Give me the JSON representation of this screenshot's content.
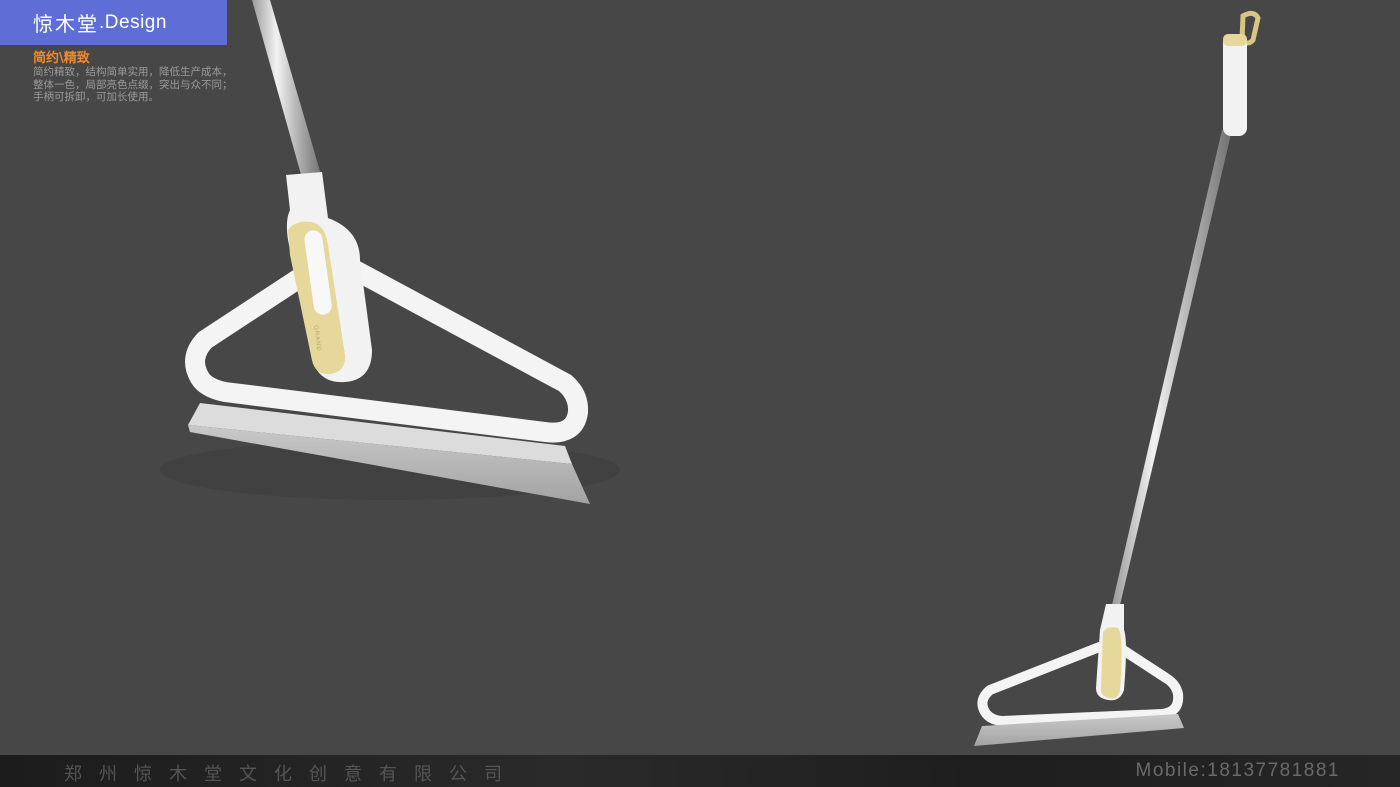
{
  "brand": {
    "name_cn": "惊木堂",
    "name_en": ".Design"
  },
  "tagline": "简约\\精致",
  "description": "简约精致，结构简单实用，降低生产成本，整体一色，局部亮色点缀，突出与众不同；手柄可拆卸，可加长使用。",
  "product_badge": "GRAND",
  "footer": {
    "company": "郑州惊木堂文化创意有限公司",
    "mobile": "Mobile:18137781881"
  },
  "colors": {
    "background": "#474747",
    "accent_blue": "#5f6ed6",
    "accent_orange": "#f08a2c",
    "product_white": "#f4f4f4",
    "product_gold": "#e6d79a"
  }
}
